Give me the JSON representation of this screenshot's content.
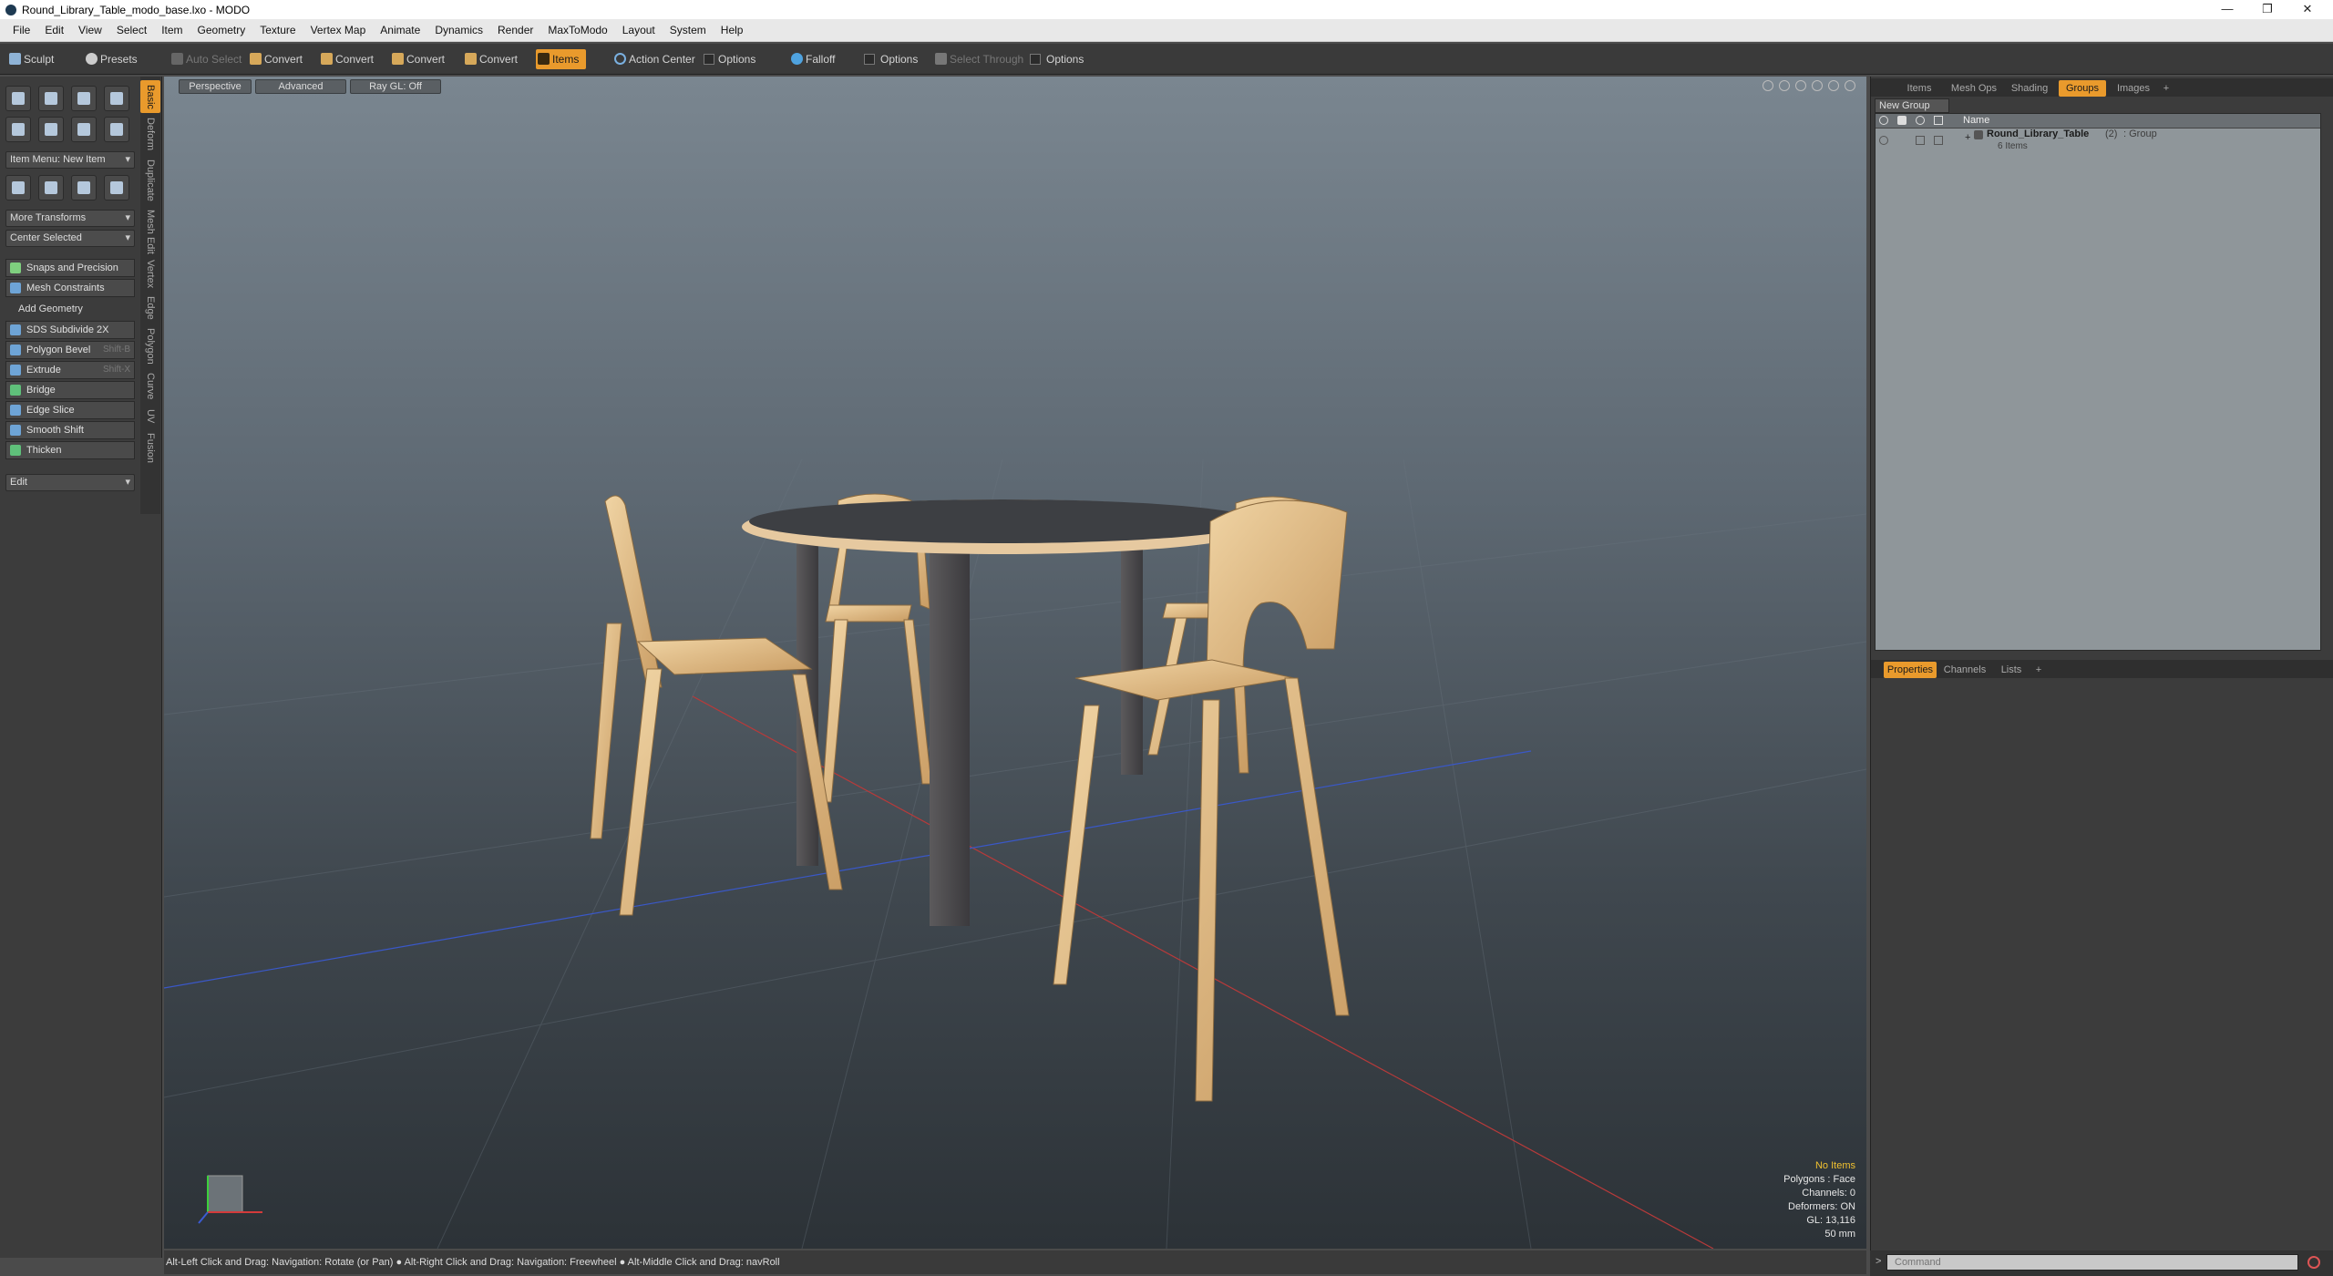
{
  "window": {
    "title": "Round_Library_Table_modo_base.lxo - MODO",
    "minimize": "—",
    "maximize": "❐",
    "close": "✕"
  },
  "menu": [
    "File",
    "Edit",
    "View",
    "Select",
    "Item",
    "Geometry",
    "Texture",
    "Vertex Map",
    "Animate",
    "Dynamics",
    "Render",
    "MaxToModo",
    "Layout",
    "System",
    "Help"
  ],
  "toolbar": {
    "sculpt": "Sculpt",
    "presets": "Presets",
    "auto_select": "Auto Select",
    "convert1": "Convert",
    "convert2": "Convert",
    "convert3": "Convert",
    "convert4": "Convert",
    "items": "Items",
    "action_center": "Action Center",
    "options1": "Options",
    "falloff": "Falloff",
    "options2": "Options",
    "select_through": "Select Through",
    "options3": "Options"
  },
  "leftpanel": {
    "item_menu": "Item Menu: New Item",
    "more_transforms": "More Transforms",
    "center_selected": "Center Selected",
    "snaps": "Snaps and Precision",
    "mesh_constraints": "Mesh Constraints",
    "add_geometry": "Add Geometry",
    "tools": [
      {
        "label": "SDS Subdivide 2X",
        "shortcut": ""
      },
      {
        "label": "Polygon Bevel",
        "shortcut": "Shift-B"
      },
      {
        "label": "Extrude",
        "shortcut": "Shift-X"
      },
      {
        "label": "Bridge",
        "shortcut": ""
      },
      {
        "label": "Edge Slice",
        "shortcut": ""
      },
      {
        "label": "Smooth Shift",
        "shortcut": ""
      },
      {
        "label": "Thicken",
        "shortcut": ""
      }
    ],
    "edit": "Edit",
    "vtabs": [
      "Basic",
      "Deform",
      "Duplicate",
      "Mesh Edit",
      "Vertex",
      "Edge",
      "Polygon",
      "Curve",
      "UV",
      "Fusion"
    ]
  },
  "viewport": {
    "perspective": "Perspective",
    "advanced": "Advanced",
    "raygl": "Ray GL: Off",
    "stats": {
      "items": "No Items",
      "polygons": "Polygons : Face",
      "channels": "Channels: 0",
      "deformers": "Deformers: ON",
      "gl": "GL: 13,116",
      "focal": "50 mm"
    }
  },
  "status": "Alt-Left Click and Drag: Navigation: Rotate (or Pan) ● Alt-Right Click and Drag: Navigation: Freewheel ● Alt-Middle Click and Drag: navRoll",
  "rightpanel": {
    "tabs": [
      "Items",
      "Mesh Ops",
      "Shading",
      "Groups",
      "Images",
      "+"
    ],
    "new_group": "New Group",
    "name_col": "Name",
    "group_name": "Round_Library_Table",
    "group_count": "(2)",
    "group_type": ": Group",
    "group_items": "6 Items",
    "ptabs": [
      "Properties",
      "Channels",
      "Lists",
      "+"
    ]
  },
  "command": {
    "placeholder": "Command"
  },
  "colors": {
    "accent": "#e99a2c",
    "wood": "#e2bd8a",
    "table_top": "#3d3f43"
  }
}
